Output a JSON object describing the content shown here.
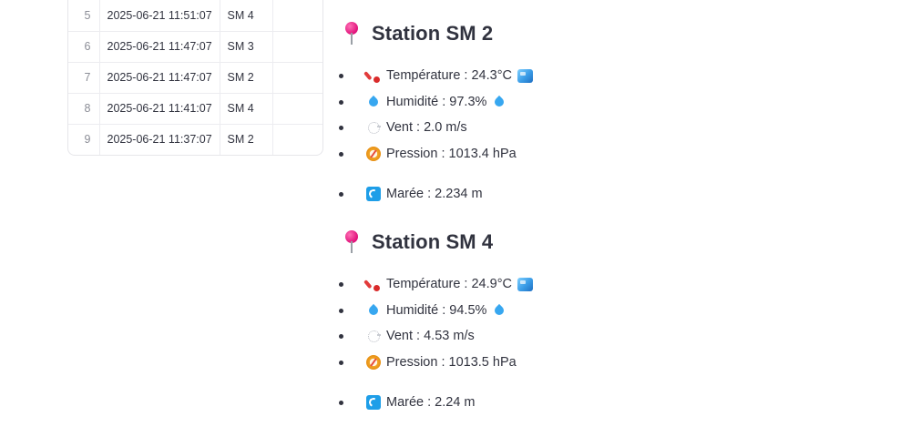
{
  "table": {
    "rows": [
      {
        "index": "5",
        "timestamp": "2025-06-21 11:51:07",
        "station": "SM 4"
      },
      {
        "index": "6",
        "timestamp": "2025-06-21 11:47:07",
        "station": "SM 3"
      },
      {
        "index": "7",
        "timestamp": "2025-06-21 11:47:07",
        "station": "SM 2"
      },
      {
        "index": "8",
        "timestamp": "2025-06-21 11:41:07",
        "station": "SM 4"
      },
      {
        "index": "9",
        "timestamp": "2025-06-21 11:37:07",
        "station": "SM 2"
      }
    ]
  },
  "stations": [
    {
      "title": "Station SM 2",
      "temperature": "Température : 24.3°C",
      "humidity": "Humidité : 97.3%",
      "wind": "Vent : 2.0 m/s",
      "pressure": "Pression : 1013.4 hPa",
      "tide": "Marée : 2.234 m"
    },
    {
      "title": "Station SM 4",
      "temperature": "Température : 24.9°C",
      "humidity": "Humidité : 94.5%",
      "wind": "Vent : 4.53 m/s",
      "pressure": "Pression : 1013.5 hPa",
      "tide": "Marée : 2.24 m"
    }
  ],
  "icons": {
    "station": "round-pushpin-icon",
    "temperature": "thermometer-icon",
    "temperature_trailing": "ice-cube-icon",
    "humidity": "droplet-icon",
    "wind": "wind-icon",
    "pressure": "compass-icon",
    "tide": "water-wave-icon"
  }
}
